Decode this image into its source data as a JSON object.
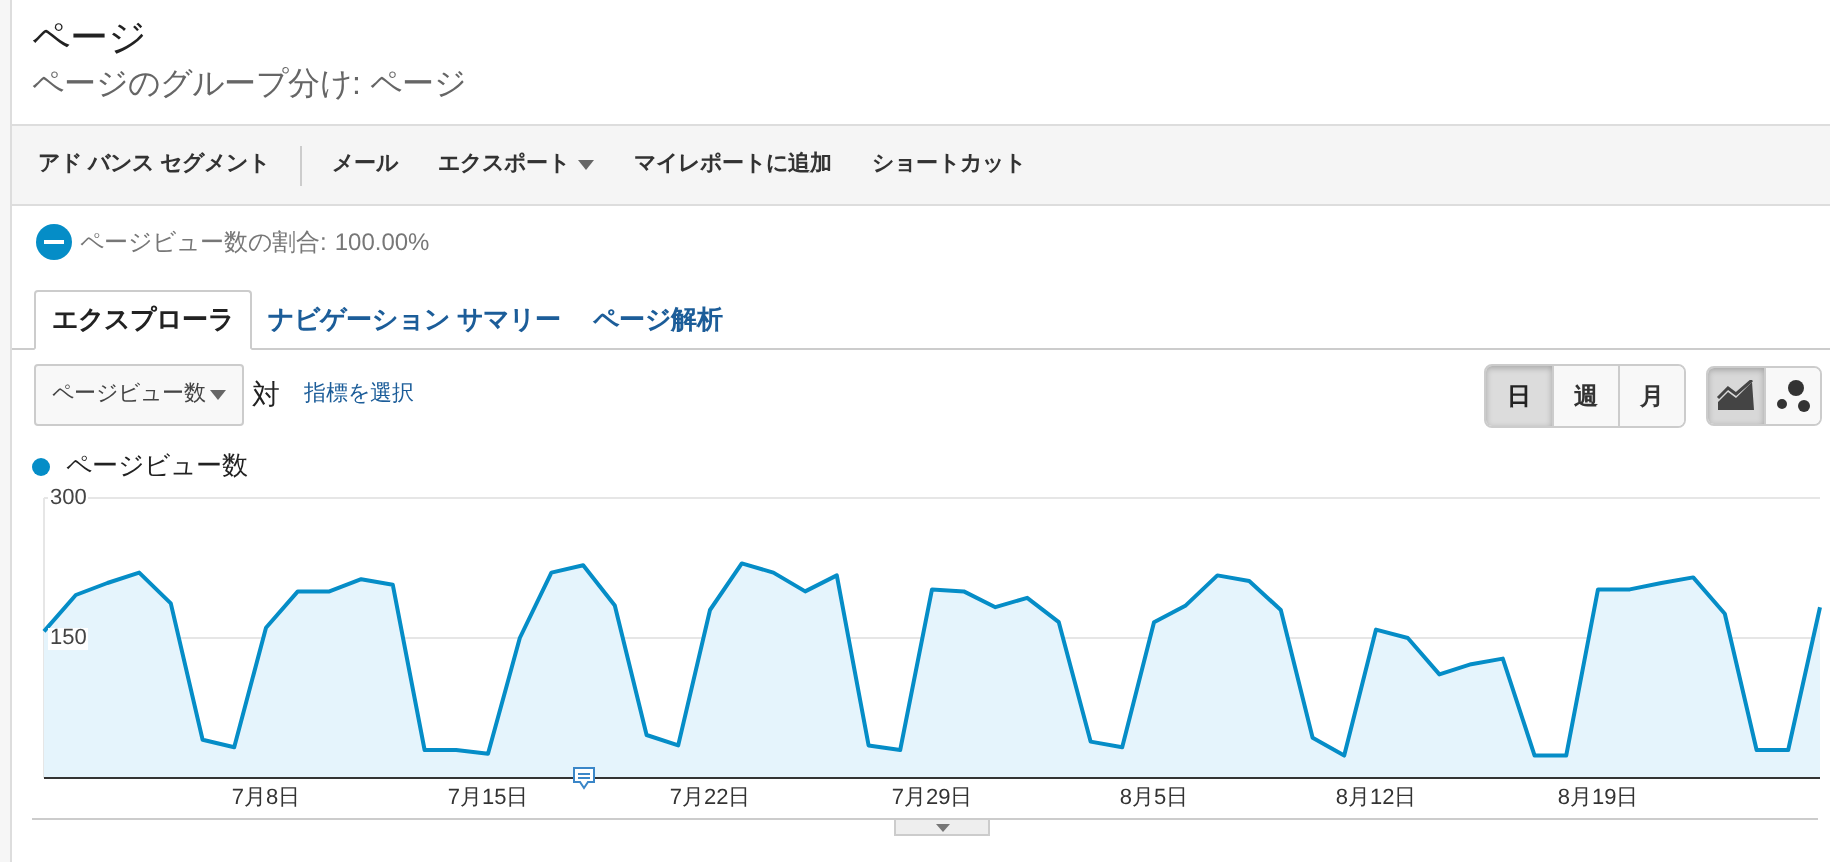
{
  "title": "ページ",
  "subtitle": "ページのグループ分け: ページ",
  "toolbar": [
    {
      "label": "アド バンス セグメント",
      "dropdown": false
    },
    {
      "label": "メール",
      "dropdown": false
    },
    {
      "label": "エクスポート",
      "dropdown": true
    },
    {
      "label": "マイレポートに追加",
      "dropdown": false
    },
    {
      "label": "ショートカット",
      "dropdown": false
    }
  ],
  "segment": {
    "label": "ページビュー数の割合:",
    "value": "100.00%"
  },
  "tabs": [
    {
      "label": "エクスプローラ",
      "selected": true
    },
    {
      "label": "ナビゲーション サマリー",
      "selected": false
    },
    {
      "label": "ページ解析",
      "selected": false
    }
  ],
  "metric_select": {
    "value": "ページビュー数"
  },
  "versus": "対",
  "choose_metric": "指標を選択",
  "period_buttons": [
    {
      "label": "日",
      "selected": true
    },
    {
      "label": "週",
      "selected": false
    },
    {
      "label": "月",
      "selected": false
    }
  ],
  "chart_type_buttons": [
    {
      "kind": "line",
      "selected": true
    },
    {
      "kind": "motion",
      "selected": false
    }
  ],
  "chart": {
    "chart_data": {
      "type": "area",
      "ylim": [
        0,
        300
      ],
      "yticks": [
        150,
        300
      ],
      "categories": [
        null,
        null,
        null,
        null,
        null,
        null,
        null,
        "7月8日",
        null,
        null,
        null,
        null,
        null,
        null,
        "7月15日",
        null,
        null,
        null,
        null,
        null,
        null,
        "7月22日",
        null,
        null,
        null,
        null,
        null,
        null,
        "7月29日",
        null,
        null,
        null,
        null,
        null,
        null,
        "8月5日",
        null,
        null,
        null,
        null,
        null,
        null,
        "8月12日",
        null,
        null,
        null,
        null,
        null,
        null,
        "8月19日",
        null,
        null,
        null,
        null,
        null,
        null,
        null
      ],
      "series": [
        {
          "name": "ページビュー数",
          "color": "#058dc7",
          "values": [
            157,
            196,
            209,
            220,
            187,
            41,
            33,
            161,
            200,
            200,
            213,
            207,
            30,
            30,
            26,
            150,
            220,
            228,
            185,
            46,
            35,
            180,
            230,
            220,
            200,
            217,
            35,
            30,
            202,
            200,
            183,
            193,
            167,
            39,
            33,
            167,
            185,
            217,
            211,
            180,
            43,
            24,
            159,
            150,
            111,
            122,
            128,
            24,
            24,
            202,
            202,
            209,
            215,
            176,
            30,
            30,
            183
          ]
        }
      ]
    }
  }
}
